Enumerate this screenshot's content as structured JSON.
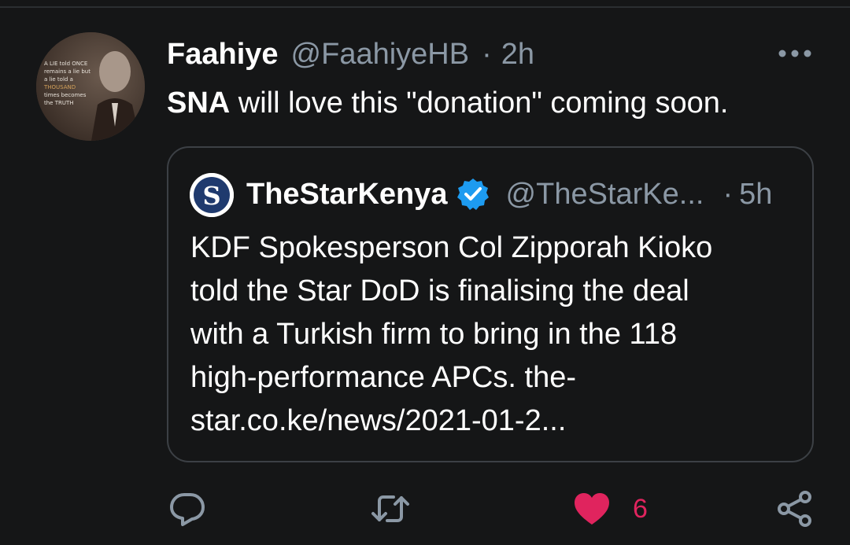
{
  "tweet": {
    "name": "Faahiye",
    "handle": "@FaahiyeHB",
    "separator": "·",
    "time": "2h",
    "text_bold": "SNA",
    "text_rest": " will love this \"donation\" coming soon.",
    "avatar_text": [
      "A LIE told ONCE",
      "remains a lie but",
      "a lie told a",
      "THOUSAND",
      "times becomes",
      "the TRUTH"
    ]
  },
  "quote": {
    "name": "TheStarKenya",
    "handle": "@TheStarKe...",
    "separator": "·",
    "time": "5h",
    "avatar_letter": "S",
    "lines": [
      "KDF Spokesperson Col Zipporah Kioko",
      "told the Star DoD is finalising the deal",
      "with a Turkish firm to bring in the 118",
      "high-performance APCs. the-",
      "star.co.ke/news/2021-01-2..."
    ]
  },
  "actions": {
    "like_count": "6",
    "icons": [
      "reply-icon",
      "retweet-icon",
      "like-icon",
      "share-icon"
    ]
  },
  "colors": {
    "background": "#151617",
    "text": "#ffffff",
    "muted": "#8b98a5",
    "border": "#3c4045",
    "like": "#e0245e",
    "verified": "#1d9bf0"
  }
}
